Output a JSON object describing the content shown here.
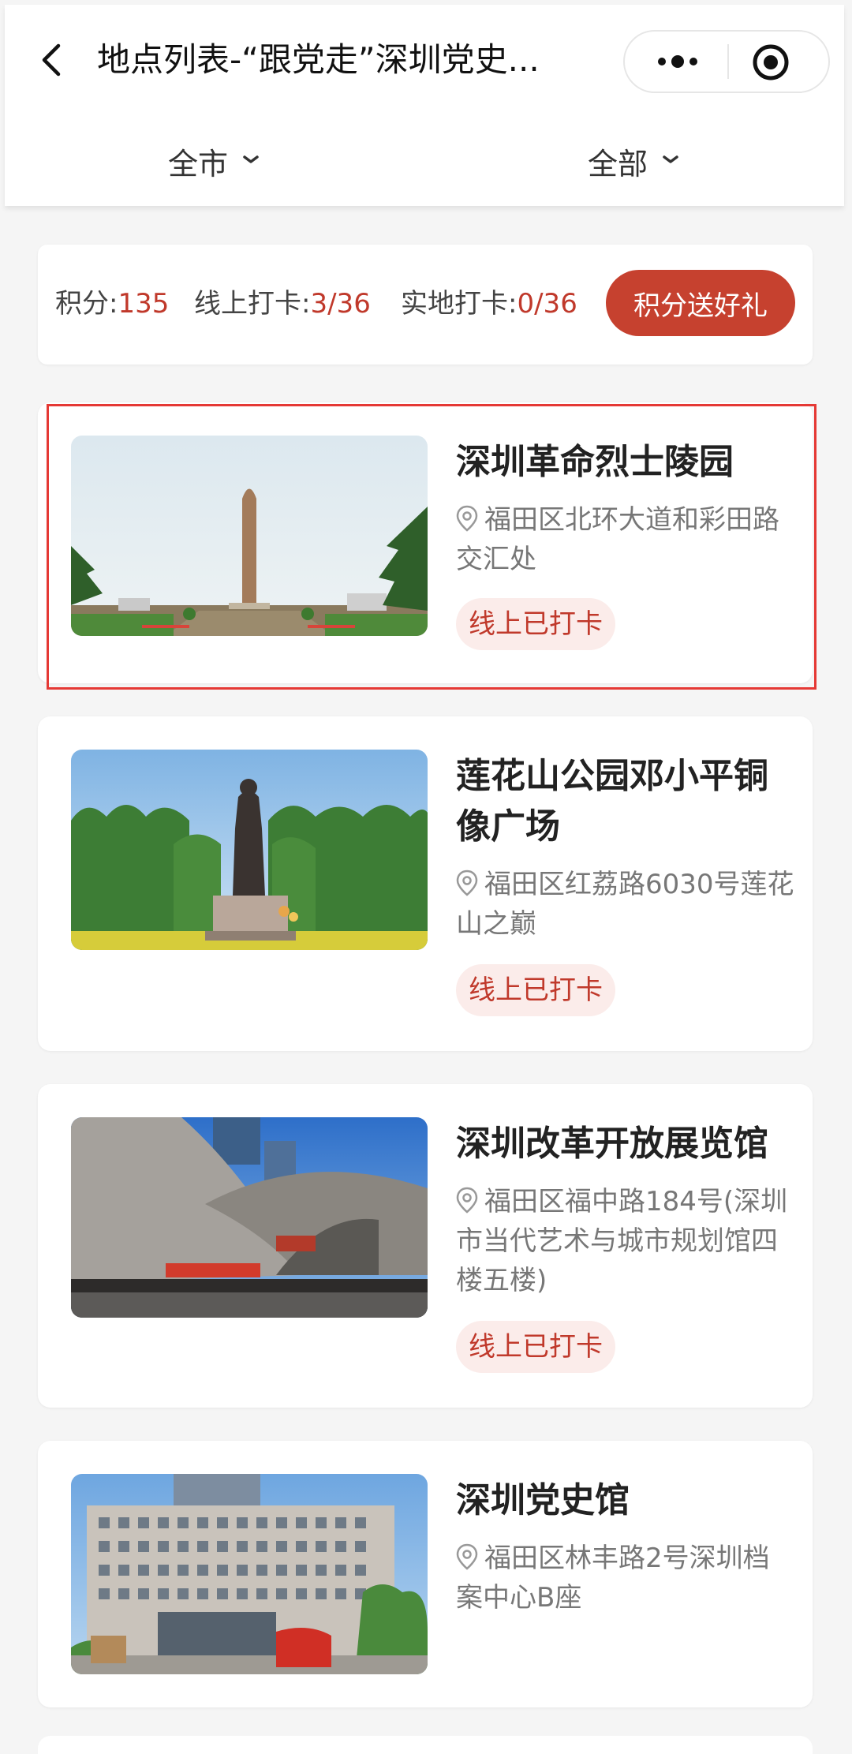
{
  "header": {
    "title": "地点列表-“跟党走”深圳党史...",
    "filters": {
      "city": "全市",
      "category": "全部"
    }
  },
  "stats": {
    "points_label": "积分:",
    "points_value": "135",
    "online_label": "线上打卡:",
    "online_value": "3/36",
    "onsite_label": "实地打卡:",
    "onsite_value": "0/36",
    "gift_button": "积分送好礼"
  },
  "locations": [
    {
      "name": "深圳革命烈士陵园",
      "address": "福田区北环大道和彩田路交汇处",
      "badge": "线上已打卡"
    },
    {
      "name": "莲花山公园邓小平铜像广场",
      "address": "福田区红荔路6030号莲花山之巅",
      "badge": "线上已打卡"
    },
    {
      "name": "深圳改革开放展览馆",
      "address": "福田区福中路184号(深圳市当代艺术与城市规划馆四楼五楼)",
      "badge": "线上已打卡"
    },
    {
      "name": "深圳党史馆",
      "address": "福田区林丰路2号深圳档案中心B座"
    }
  ],
  "colors": {
    "accent": "#c6412f",
    "accent_text": "#c0392b",
    "badge_bg": "#fbecea",
    "highlight": "#e53935"
  },
  "icons": {
    "back": "chevron-left-icon",
    "menu": "more-dots-icon",
    "close": "target-circle-icon",
    "dropdown": "chevron-down-icon",
    "location": "map-pin-icon"
  }
}
